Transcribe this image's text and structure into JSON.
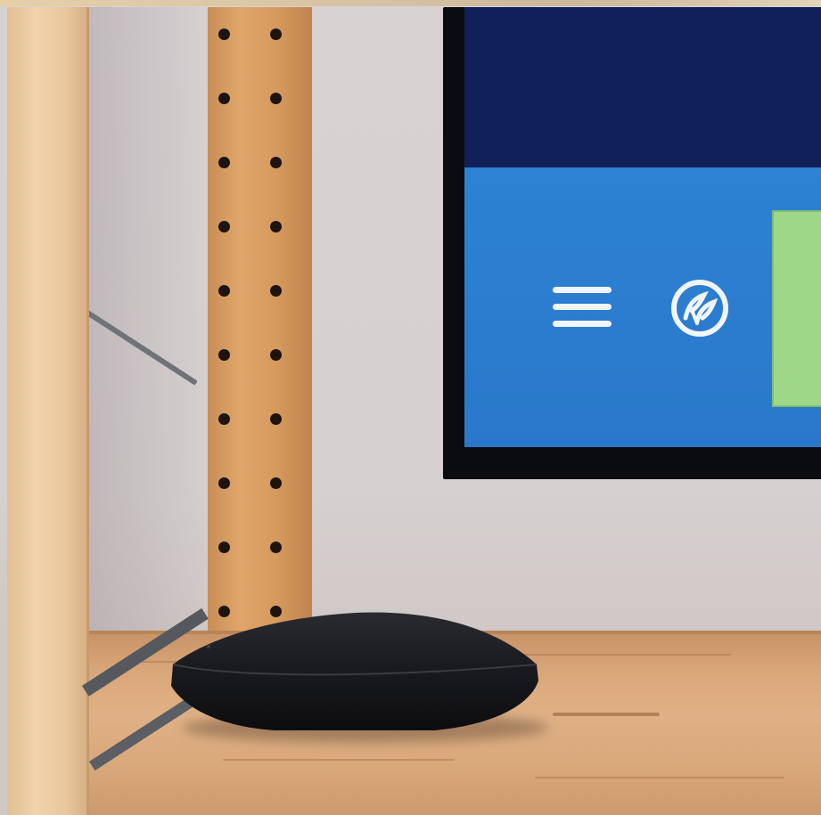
{
  "scene": {
    "objects": {
      "tv": {
        "screen": {
          "menu_icon": "hamburger-menu-icon",
          "logo_icon": "leaf-logo-icon"
        }
      },
      "device": "streaming-box",
      "pegboard": "pegboard",
      "shelf": "wooden-shelf"
    },
    "colors": {
      "screen_top": "#10215a",
      "screen_main": "#2d82d3",
      "tile": "#9fd789",
      "device": "#151518",
      "wood": "#d9a679"
    }
  }
}
